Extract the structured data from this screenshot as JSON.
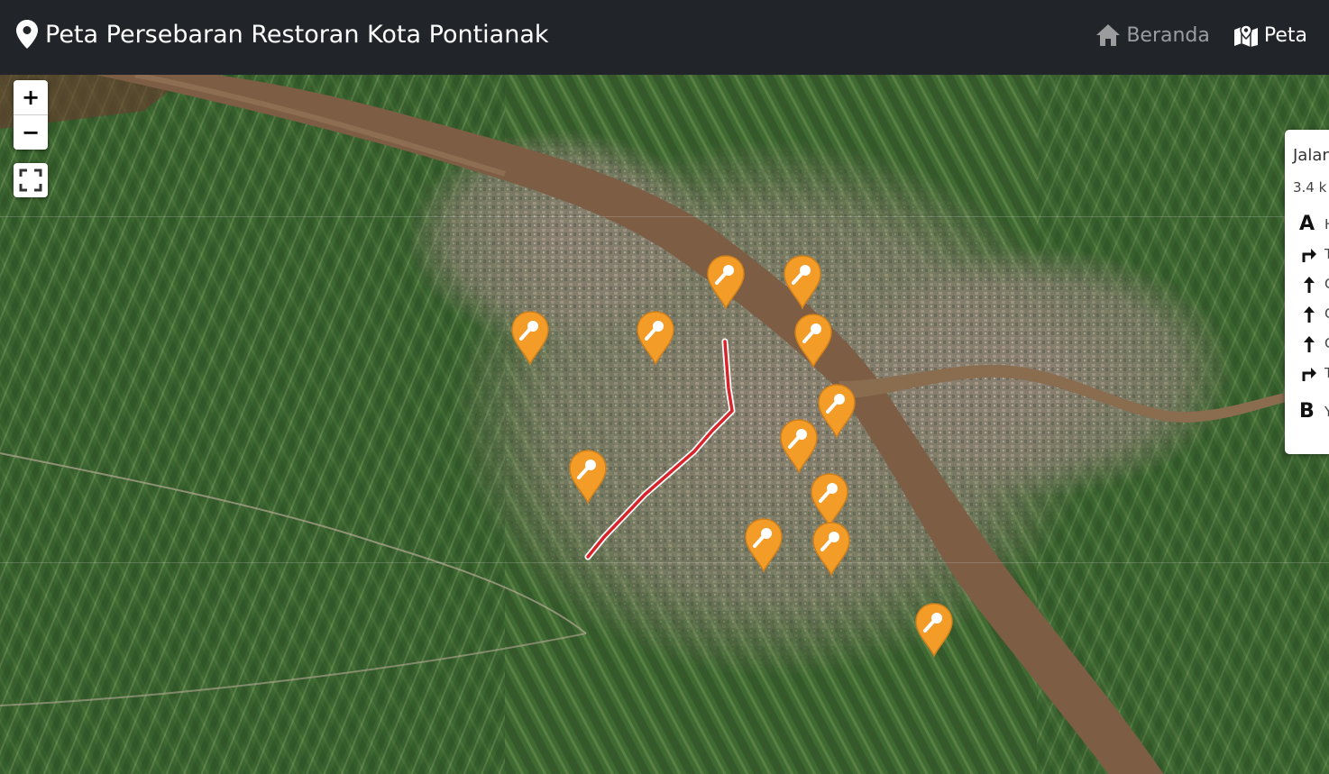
{
  "navbar": {
    "brand_icon": "map-pin-icon",
    "title": "Peta Persebaran Restoran Kota Pontianak",
    "links": [
      {
        "label": "Beranda",
        "icon": "home-icon",
        "active": false
      },
      {
        "label": "Peta",
        "icon": "map-icon",
        "active": true
      }
    ]
  },
  "map": {
    "layer": "satellite",
    "controls": {
      "zoom_in": "+",
      "zoom_out": "−",
      "fullscreen_icon": "fullscreen-icon"
    },
    "marker_icon": "restaurant-marker-icon",
    "marker_color": "#f39c27",
    "route_color": "#d7242b",
    "marker_count": 12
  },
  "route_panel": {
    "title": "Jalan",
    "summary": "3.4 k",
    "steps": [
      {
        "icon": "A",
        "text": "H"
      },
      {
        "icon": "turn-right-icon",
        "text": "T"
      },
      {
        "icon": "straight-icon",
        "text": "C"
      },
      {
        "icon": "straight-icon",
        "text": "C"
      },
      {
        "icon": "straight-icon",
        "text": "C"
      },
      {
        "icon": "turn-right-icon",
        "text": "T"
      },
      {
        "icon": "B",
        "text": "Y"
      }
    ]
  }
}
